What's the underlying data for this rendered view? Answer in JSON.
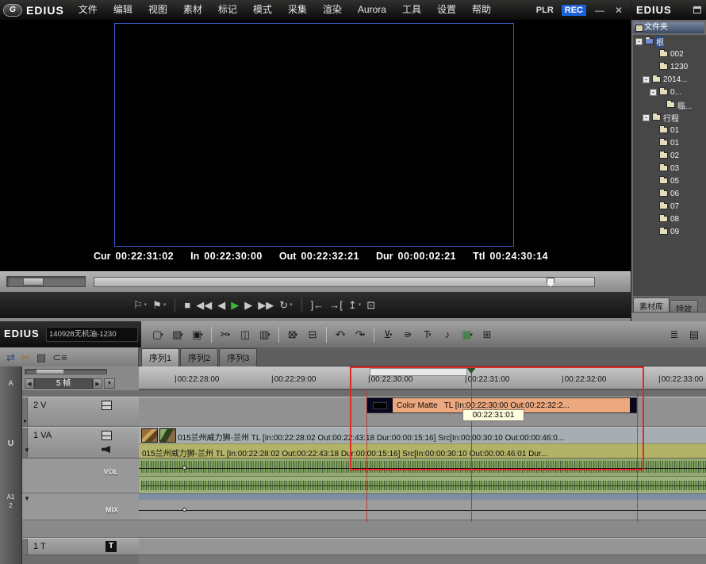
{
  "menu_bar": {
    "logo_text": "EDIUS",
    "logo_glyph": "G",
    "menus": [
      "文件",
      "编辑",
      "视图",
      "素材",
      "标记",
      "模式",
      "采集",
      "渲染",
      "Aurora",
      "工具",
      "设置",
      "帮助"
    ],
    "plr": "PLR",
    "rec": "REC",
    "minimize": "—",
    "close": "✕"
  },
  "preview": {
    "timecodes": [
      {
        "label": "Cur",
        "value": "00:22:31:02"
      },
      {
        "label": "In",
        "value": "00:22:30:00"
      },
      {
        "label": "Out",
        "value": "00:22:32:21"
      },
      {
        "label": "Dur",
        "value": "00:00:02:21"
      },
      {
        "label": "Ttl",
        "value": "00:24:30:14"
      }
    ]
  },
  "transport": {
    "buttons": [
      {
        "name": "previous-edit-point",
        "glyph": "⚐",
        "dd": true
      },
      {
        "name": "next-edit-point",
        "glyph": "⚑",
        "dd": true
      },
      {
        "sep": true
      },
      {
        "name": "stop",
        "glyph": "■"
      },
      {
        "name": "rewind",
        "glyph": "◀◀"
      },
      {
        "name": "previous-frame",
        "glyph": "◀"
      },
      {
        "name": "play",
        "glyph": "▶",
        "color": "#3db53d"
      },
      {
        "name": "next-frame",
        "glyph": "▶"
      },
      {
        "name": "fast-forward",
        "glyph": "▶▶"
      },
      {
        "name": "loop-playback",
        "glyph": "↻",
        "dd": true
      },
      {
        "sep": true
      },
      {
        "name": "set-in-point",
        "glyph": "]←"
      },
      {
        "name": "set-out-point",
        "glyph": "→["
      },
      {
        "name": "jump-to-in",
        "glyph": "↥",
        "dd": true
      },
      {
        "name": "display-mode",
        "glyph": "⊡"
      }
    ]
  },
  "bin": {
    "title": "EDIUS",
    "folder_header": "文件夹",
    "tree": [
      {
        "label": "根",
        "depth": 0,
        "expander": "-",
        "root": true,
        "active": true
      },
      {
        "label": "002",
        "depth": 2
      },
      {
        "label": "1230",
        "depth": 2
      },
      {
        "label": "2014...",
        "depth": 1,
        "expander": "-"
      },
      {
        "label": "0...",
        "depth": 2,
        "expander": "-"
      },
      {
        "label": "临...",
        "depth": 3
      },
      {
        "label": "行程",
        "depth": 1,
        "expander": "-"
      },
      {
        "label": "01",
        "depth": 2
      },
      {
        "label": "01",
        "depth": 2
      },
      {
        "label": "02",
        "depth": 2
      },
      {
        "label": "03",
        "depth": 2
      },
      {
        "label": "05",
        "depth": 2
      },
      {
        "label": "06",
        "depth": 2
      },
      {
        "label": "07",
        "depth": 2
      },
      {
        "label": "08",
        "depth": 2
      },
      {
        "label": "09",
        "depth": 2
      }
    ],
    "tabs": [
      {
        "label": "素材库",
        "active": true
      },
      {
        "label": "特效"
      }
    ]
  },
  "timeline": {
    "app_label": "EDIUS",
    "sequence_name": "140928无机油-1230",
    "toolbar": [
      {
        "name": "new-sequence",
        "glyph": "▢",
        "dd": true
      },
      {
        "name": "open-project",
        "glyph": "▧",
        "dd": true
      },
      {
        "name": "save-project",
        "glyph": "▣",
        "dd": true
      },
      {
        "sep": true
      },
      {
        "name": "cut",
        "glyph": "✂",
        "dd": true
      },
      {
        "name": "copy",
        "glyph": "◫"
      },
      {
        "name": "paste",
        "glyph": "▥",
        "dd": true
      },
      {
        "sep": true
      },
      {
        "name": "ripple-delete",
        "glyph": "⊠",
        "dd": true
      },
      {
        "name": "delete",
        "glyph": "⊟"
      },
      {
        "sep": true
      },
      {
        "name": "undo",
        "glyph": "↶",
        "dd": true
      },
      {
        "name": "redo",
        "glyph": "↷",
        "dd": true
      },
      {
        "sep": true
      },
      {
        "name": "add-cut-point",
        "glyph": "⊻",
        "dd": true
      },
      {
        "name": "edit-mode",
        "glyph": "≡",
        "dd": true
      },
      {
        "name": "add-title",
        "glyph": "T",
        "dd": true
      },
      {
        "name": "voice-over",
        "glyph": "♪"
      },
      {
        "name": "color-correction",
        "glyph": "▦",
        "color": "#2f7d33",
        "dd": true
      },
      {
        "name": "export",
        "glyph": "⊞"
      },
      {
        "gap": true
      },
      {
        "name": "audio-mixer",
        "glyph": "≣"
      },
      {
        "name": "effects-palette",
        "glyph": "▤"
      }
    ],
    "mini_toolbar": [
      {
        "name": "insert-overwrite-mode",
        "glyph": "⇄",
        "color": "#27417e"
      },
      {
        "name": "ripple-mode",
        "glyph": "✂",
        "color": "#a06d1c"
      },
      {
        "name": "sync-lock",
        "glyph": "▧",
        "color": "#2a2a2a"
      },
      {
        "name": "audio-link",
        "glyph": "⊂≡",
        "color": "#2a2a2a"
      }
    ],
    "tabs": [
      {
        "label": "序列1",
        "active": true
      },
      {
        "label": "序列2"
      },
      {
        "label": "序列3"
      }
    ],
    "ruler": {
      "ticks": [
        "00:22:28:00",
        "00:22:29:00",
        "00:22:30:00",
        "00:22:31:00",
        "00:22:32:00",
        "00:22:33:00"
      ]
    },
    "track_panel": {
      "auto_label": "A",
      "frame_step": "5 帧",
      "step_prev": "◀",
      "step_next": "▶",
      "step_dd": "▼",
      "mute_label": "U",
      "channel_label_1": "A1",
      "channel_label_2": "2",
      "tracks": {
        "video": "2 V",
        "va": "1 VA",
        "title": "1 T"
      },
      "expand_collapsed": "▸",
      "expand_open": "▼",
      "vol": "VOL",
      "mix": "MIX",
      "t_icon": "T"
    },
    "clips": {
      "color_matte": {
        "title": "Color Matte",
        "info": "TL [In:00:22:30:00 Out:00:22:32:2..."
      },
      "tooltip": "00:22:31:01",
      "va_video": "015兰州威力狮-兰州  TL [In:00:22:28:02 Out:00:22:43:18 Dur:00:00:15:16]  Src[In:00:00:30:10 Out:00:00:46:0...",
      "va_audio": "015兰州威力狮-兰州  TL [In:00:22:28:02 Out:00:22:43:18 Dur:00:00:15:16] Src[In:00:00:30:10 Out:00:00:46:01 Dur..."
    },
    "colors": {
      "selection_box": "#df2a2a",
      "playhead": "#c03030",
      "clip_matte": "#eca87e",
      "clip_audio_row": "#b3b368",
      "rec_badge": "#1d5fd8"
    }
  }
}
